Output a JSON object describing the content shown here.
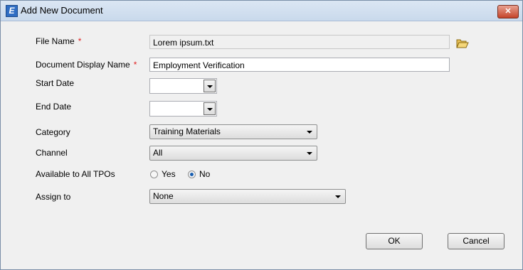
{
  "window": {
    "title": "Add New Document",
    "app_icon": "E",
    "close": "✕"
  },
  "form": {
    "file_name": {
      "label": "File Name",
      "required": "*",
      "value": "Lorem ipsum.txt"
    },
    "display_name": {
      "label": "Document Display Name",
      "required": "*",
      "value": "Employment Verification"
    },
    "start_date": {
      "label": "Start Date",
      "value": ""
    },
    "end_date": {
      "label": "End Date",
      "value": ""
    },
    "category": {
      "label": "Category",
      "value": "Training Materials"
    },
    "channel": {
      "label": "Channel",
      "value": "All"
    },
    "available": {
      "label": "Available to All TPOs",
      "yes": "Yes",
      "no": "No",
      "selected": "No"
    },
    "assign": {
      "label": "Assign to",
      "value": "None"
    }
  },
  "buttons": {
    "ok": "OK",
    "cancel": "Cancel"
  },
  "icons": {
    "browse": "folder-open-icon",
    "dropdown": "chevron-down-icon"
  },
  "colors": {
    "required": "#e02020",
    "titlebar": "#c9d9ec",
    "radio_selected": "#1a5fb0"
  }
}
